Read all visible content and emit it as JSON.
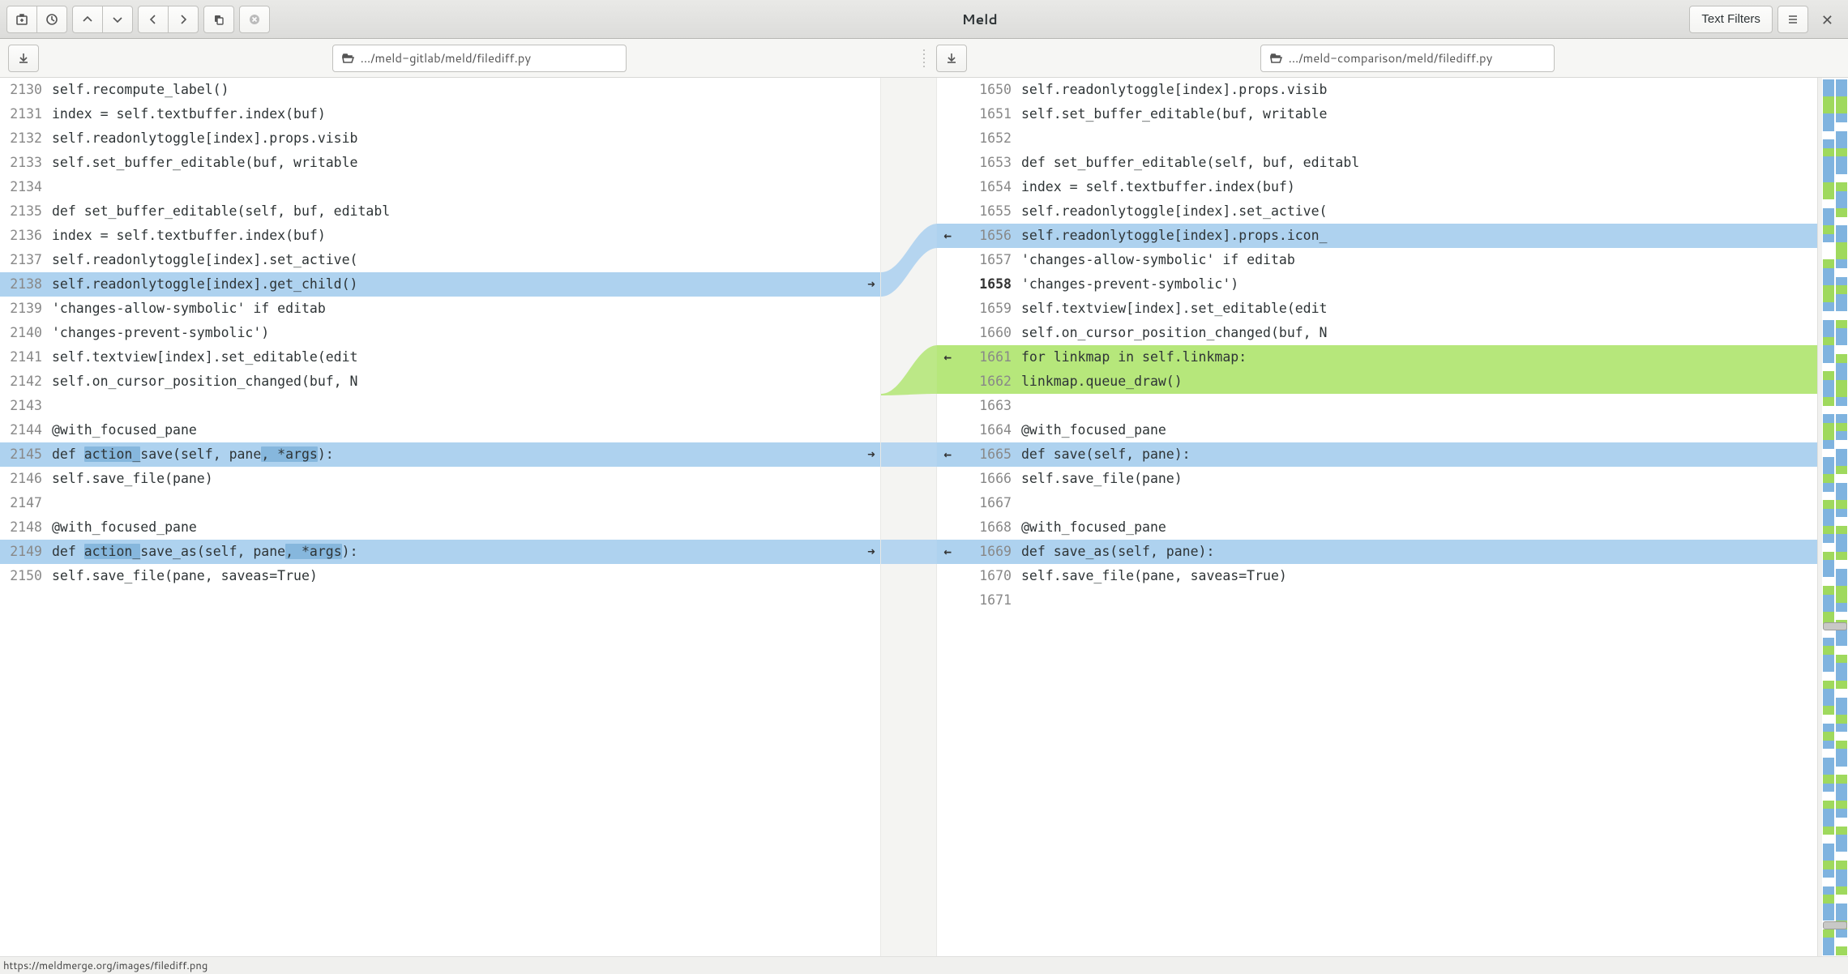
{
  "app_title": "Meld",
  "header": {
    "text_filters_label": "Text Filters"
  },
  "paths": {
    "left": ".../meld-gitlab/meld/filediff.py",
    "right": ".../meld-comparison/meld/filediff.py"
  },
  "status_text": "https://meldmerge.org/images/filediff.png",
  "lines": {
    "left": [
      {
        "n": 2130,
        "t": "        self.recompute_label()"
      },
      {
        "n": 2131,
        "t": "        index = self.textbuffer.index(buf)"
      },
      {
        "n": 2132,
        "t": "        self.readonlytoggle[index].props.visib"
      },
      {
        "n": 2133,
        "t": "        self.set_buffer_editable(buf, writable"
      },
      {
        "n": 2134,
        "t": ""
      },
      {
        "n": 2135,
        "t": "    def set_buffer_editable(self, buf, editabl"
      },
      {
        "n": 2136,
        "t": "        index = self.textbuffer.index(buf)"
      },
      {
        "n": 2137,
        "t": "        self.readonlytoggle[index].set_active("
      },
      {
        "n": 2138,
        "t": "        self.readonlytoggle[index].get_child()",
        "cls": "blue",
        "ra": "➜"
      },
      {
        "n": 2139,
        "t": "            'changes-allow-symbolic' if editab"
      },
      {
        "n": 2140,
        "t": "            'changes-prevent-symbolic')"
      },
      {
        "n": 2141,
        "t": "        self.textview[index].set_editable(edit"
      },
      {
        "n": 2142,
        "t": "        self.on_cursor_position_changed(buf, N"
      },
      {
        "n": 2143,
        "t": ""
      },
      {
        "n": 2144,
        "t": "    @with_focused_pane"
      },
      {
        "n": 2145,
        "t": "    def action_save(self, pane, *args):",
        "cls": "blue",
        "ra": "➜",
        "hl": [
          "action_",
          ", *args"
        ]
      },
      {
        "n": 2146,
        "t": "        self.save_file(pane)"
      },
      {
        "n": 2147,
        "t": ""
      },
      {
        "n": 2148,
        "t": "    @with_focused_pane"
      },
      {
        "n": 2149,
        "t": "    def action_save_as(self, pane, *args):",
        "cls": "blue",
        "ra": "➜",
        "hl": [
          "action_",
          ", *args"
        ]
      },
      {
        "n": 2150,
        "t": "        self.save_file(pane, saveas=True)"
      },
      {
        "n": "",
        "t": ""
      }
    ],
    "right": [
      {
        "n": 1650,
        "t": "        self.readonlytoggle[index].props.visib"
      },
      {
        "n": 1651,
        "t": "        self.set_buffer_editable(buf, writable"
      },
      {
        "n": 1652,
        "t": ""
      },
      {
        "n": 1653,
        "t": "    def set_buffer_editable(self, buf, editabl"
      },
      {
        "n": 1654,
        "t": "        index = self.textbuffer.index(buf)"
      },
      {
        "n": 1655,
        "t": "        self.readonlytoggle[index].set_active("
      },
      {
        "n": 1656,
        "t": "        self.readonlytoggle[index].props.icon_",
        "cls": "blue",
        "la": "←"
      },
      {
        "n": 1657,
        "t": "            'changes-allow-symbolic' if editab"
      },
      {
        "n": 1658,
        "t": "            'changes-prevent-symbolic')",
        "bold": true
      },
      {
        "n": 1659,
        "t": "        self.textview[index].set_editable(edit"
      },
      {
        "n": 1660,
        "t": "        self.on_cursor_position_changed(buf, N"
      },
      {
        "n": 1661,
        "t": "        for linkmap in self.linkmap:",
        "cls": "green",
        "la": "←"
      },
      {
        "n": 1662,
        "t": "            linkmap.queue_draw()",
        "cls": "green"
      },
      {
        "n": 1663,
        "t": ""
      },
      {
        "n": 1664,
        "t": "    @with_focused_pane"
      },
      {
        "n": 1665,
        "t": "    def save(self, pane):",
        "cls": "blue",
        "la": "←"
      },
      {
        "n": 1666,
        "t": "        self.save_file(pane)"
      },
      {
        "n": 1667,
        "t": ""
      },
      {
        "n": 1668,
        "t": "    @with_focused_pane"
      },
      {
        "n": 1669,
        "t": "    def save_as(self, pane):",
        "cls": "blue",
        "la": "←"
      },
      {
        "n": 1670,
        "t": "        self.save_file(pane, saveas=True)"
      },
      {
        "n": 1671,
        "t": ""
      }
    ]
  },
  "overview_pattern": [
    "bbggbbwbgbbbggwbbgbwwgbbggbwbbgbbwgbbgwbggbwbbgbwgbbgbwgbbwgbbggwbgbbwgbbgwbgbwbbgbwgbbgwbbgbwbgbbwgbb",
    "bbggbwbbgbbwgbbgwbbggbwbgbbwgbbwgbbggbwbgbwbbgwbbgbwgbbgwbbggbwgbbwgbbgwbbgbwgbbwgbbgbwgbbwgbbgwbbgbwg"
  ]
}
